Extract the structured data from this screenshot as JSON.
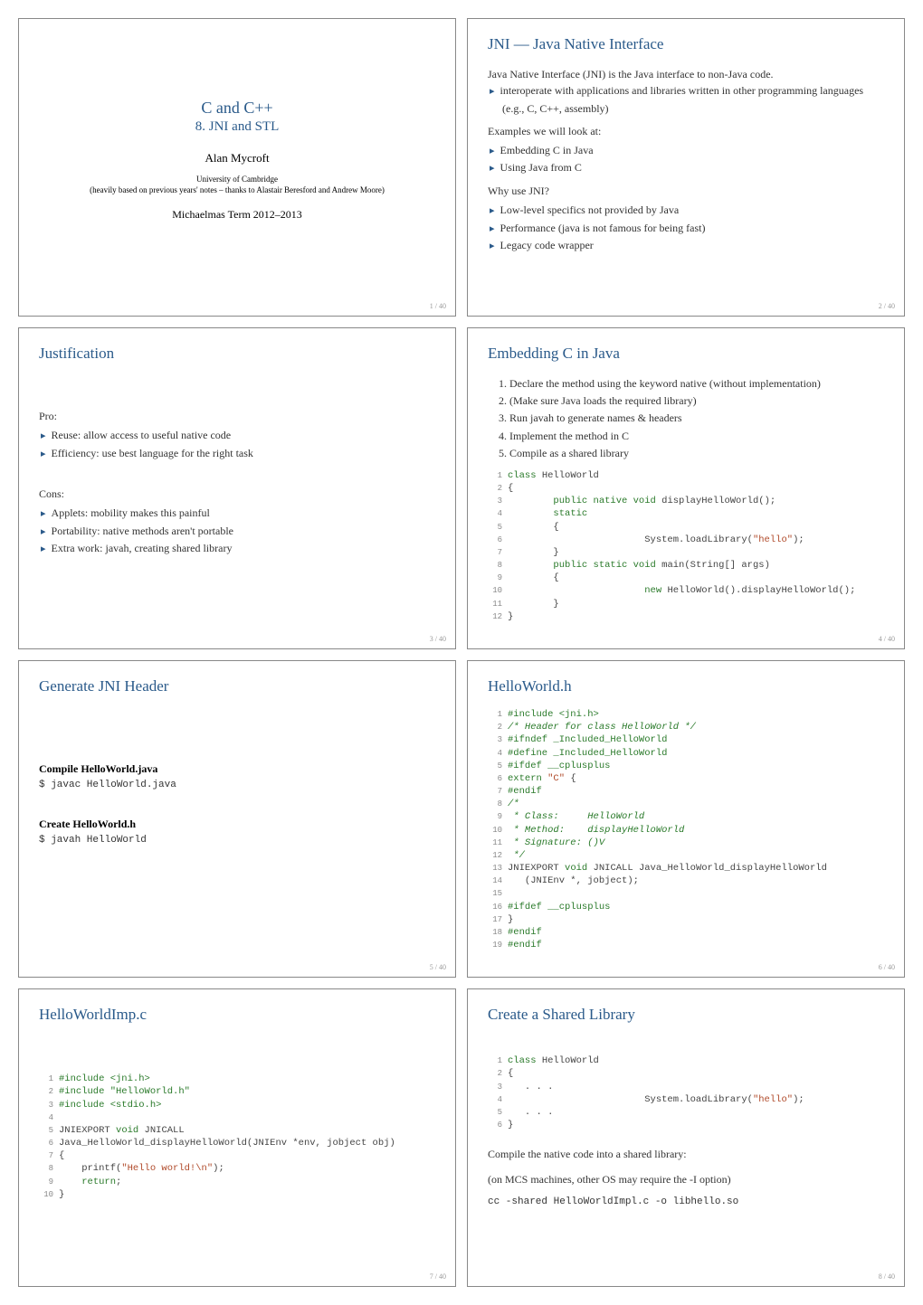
{
  "slides": {
    "s1": {
      "title_main": "C and C++",
      "title_sub": "8. JNI and STL",
      "author": "Alan Mycroft",
      "affil_line1": "University of Cambridge",
      "affil_line2": "(heavily based on previous years' notes – thanks to Alastair Beresford and Andrew Moore)",
      "term": "Michaelmas Term 2012–2013",
      "pagenum": "1 / 40"
    },
    "s2": {
      "title": "JNI — Java Native Interface",
      "intro": "Java Native Interface (JNI) is the Java interface to non-Java code.",
      "b1": "interoperate with applications and libraries written in other programming languages (e.g., C, C++, assembly)",
      "ex_label": "Examples we will look at:",
      "ex1": "Embedding C in Java",
      "ex2": "Using Java from C",
      "why_label": "Why use JNI?",
      "w1": "Low-level specifics not provided by Java",
      "w2": "Performance (java is not famous for being fast)",
      "w3": "Legacy code wrapper",
      "pagenum": "2 / 40"
    },
    "s3": {
      "title": "Justification",
      "pro_label": "Pro:",
      "p1": "Reuse: allow access to useful native code",
      "p2": "Efficiency: use best language for the right task",
      "cons_label": "Cons:",
      "c1": "Applets: mobility makes this painful",
      "c2": "Portability: native methods aren't portable",
      "c3": "Extra work: javah, creating shared library",
      "pagenum": "3 / 40"
    },
    "s4": {
      "title": "Embedding C in Java",
      "n1": "Declare the method using the keyword native (without implementation)",
      "n2": "(Make sure Java loads the required library)",
      "n3": "Run javah to generate names & headers",
      "n4": "Implement the method in C",
      "n5": "Compile as a shared library",
      "pagenum": "4 / 40"
    },
    "s5": {
      "title": "Generate JNI Header",
      "h1": "Compile HelloWorld.java",
      "cmd1": "$ javac HelloWorld.java",
      "h2": "Create HelloWorld.h",
      "cmd2": "$ javah HelloWorld",
      "pagenum": "5 / 40"
    },
    "s6": {
      "title": "HelloWorld.h",
      "pagenum": "6 / 40"
    },
    "s7": {
      "title": "HelloWorldImp.c",
      "pagenum": "7 / 40"
    },
    "s8": {
      "title": "Create a Shared Library",
      "compile_text": "Compile the native code into a shared library:",
      "mcs_text": "(on MCS machines, other OS may require the -I option)",
      "cc_cmd": "cc -shared HelloWorldImpl.c -o libhello.so",
      "pagenum": "8 / 40"
    }
  }
}
